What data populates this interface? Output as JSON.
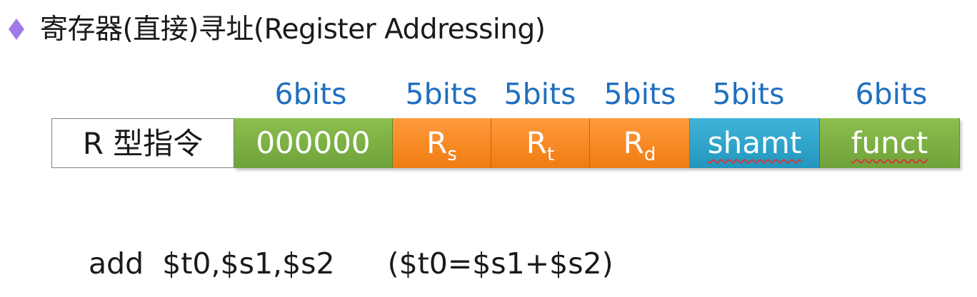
{
  "slide": {
    "title": "寄存器(直接)寻址(Register Addressing)",
    "bullet_icon": "diamond-bullet-icon",
    "bullet_color": "#a079e8"
  },
  "format": {
    "bits": [
      "6bits",
      "5bits",
      "5bits",
      "5bits",
      "5bits",
      "6bits"
    ],
    "type_label": "R 型指令",
    "fields": [
      {
        "text": "000000",
        "sub": ""
      },
      {
        "text": "R",
        "sub": "s"
      },
      {
        "text": "R",
        "sub": "t"
      },
      {
        "text": "R",
        "sub": "d"
      },
      {
        "text": "shamt",
        "sub": ""
      },
      {
        "text": "funct",
        "sub": ""
      }
    ],
    "colors": {
      "opcode_green": "#7cb043",
      "register_orange": "#f7891f",
      "shamt_blue": "#2ea5cc",
      "bits_label_blue": "#1f6fc0"
    }
  },
  "example": {
    "instruction": "add  $t0,$s1,$s2",
    "meaning": "($t0=$s1+$s2)"
  }
}
